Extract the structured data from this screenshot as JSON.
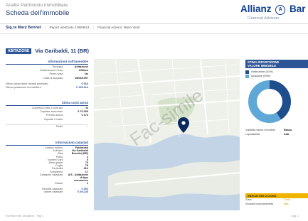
{
  "header": {
    "kicker": "Analisi Patrimonio Immobiliare",
    "title": "Scheda dell'immobile",
    "brand": "Allianz",
    "brand_mark": "A",
    "brand_tail": "Bar",
    "brand_sub": "Financial Advisors"
  },
  "subbar": {
    "client": "Sig.ra Mary Bennet",
    "report_label": "Report realizzato il 08/08/14",
    "advisor_label": "Financial Advisor: Mario Verdi"
  },
  "property": {
    "badge": "ABITAZIONE",
    "address": "Via Garibaldi, 11 (BR)"
  },
  "info": {
    "title": "Informazioni sull'immobile",
    "rows": [
      {
        "label": "Tipologia",
        "value": "Abitazione"
      },
      {
        "label": "Destinazione d'uso",
        "value": "Utilizzo"
      },
      {
        "label": "Prima casa",
        "value": "No"
      },
      {
        "label": "Data di acquisto",
        "value": "15/04/1997"
      }
    ],
    "wide_rows": [
      {
        "label": "Stima valore della rendita (mensile)",
        "value": "€ 663"
      },
      {
        "label": "Stima quotazione immobiliare",
        "value": "€ 195.614"
      }
    ]
  },
  "costs": {
    "title": "Stima costi annui",
    "rows": [
      {
        "label": "Copertura furto e incendio",
        "value": "Si"
      },
      {
        "label": "Capitale assicurato",
        "value": "€ 70.000"
      },
      {
        "label": "Premio annuo",
        "value": "€ 174"
      },
      {
        "label": "Imposte e tasse",
        "value": ""
      }
    ],
    "total_label": "Totale",
    "total_value": "-"
  },
  "cadastre": {
    "title": "Informazioni catastali",
    "rows": [
      {
        "label": "Catasto edilizio",
        "value": "Fabbricati"
      },
      {
        "label": "Indirizzo",
        "value": "Via Garibaldi"
      },
      {
        "label": "Città",
        "value": "Brindisi (BR)"
      },
      {
        "label": "Piano",
        "value": "2"
      },
      {
        "label": "Numero vani",
        "value": "5"
      },
      {
        "label": "Metri quadri",
        "value": "70"
      },
      {
        "label": "Foglio",
        "value": "78"
      },
      {
        "label": "Particella",
        "value": "812"
      },
      {
        "label": "Subalterno",
        "value": "17"
      }
    ],
    "category_label": "Categoria catastale",
    "category_value": "A/3 - Abitazione di tipo economico",
    "class_label": "Classe",
    "class_value": "2",
    "income_rows": [
      {
        "label": "Rendita catastale",
        "value": "€ 852"
      },
      {
        "label": "Valore catastale",
        "value": "€ 89.226"
      }
    ]
  },
  "map": {
    "watermark": "Fac-simile",
    "marker_icon": "map-pin-icon"
  },
  "distribution": {
    "title_line1": "STIMA RIPARTIZIONE",
    "title_line2": "VALORE IMMOBILE",
    "legend": [
      {
        "label": "costruzione (41%)",
        "color": "#1f4e8c"
      },
      {
        "label": "locazione (59%)",
        "color": "#5fa7d6"
      }
    ],
    "kv": [
      {
        "label": "Volatilità valore immobile",
        "value": "Bassa"
      },
      {
        "label": "Liquidabilità",
        "value": "Alta"
      }
    ]
  },
  "zone": {
    "title": "INDICATORI DI ZONA",
    "kv": [
      {
        "label": "Zona",
        "value": "Centr"
      },
      {
        "label": "Vivacità compravendite",
        "value": "Alta"
      }
    ]
  },
  "footer": {
    "text": "Everbydi este. Disclaimer - Pag 1",
    "page": "pag. 1"
  },
  "colors": {
    "brand_blue": "#2d5596",
    "accent_gold": "#f0b400",
    "donut_dark": "#1f4e8c",
    "donut_light": "#5fa7d6"
  },
  "chart_data": {
    "type": "pie",
    "categories": [
      "costruzione",
      "locazione"
    ],
    "values": [
      41,
      59
    ],
    "title": "STIMA RIPARTIZIONE VALORE IMMOBILE"
  }
}
